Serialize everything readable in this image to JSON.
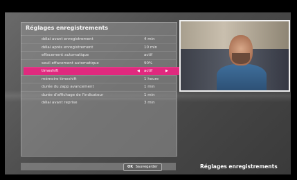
{
  "menu": {
    "title": "Réglages enregistrements",
    "items": [
      {
        "label": "délai avant enregistrement",
        "value": "4 min"
      },
      {
        "label": "délai après enregistrement",
        "value": "10 min"
      },
      {
        "label": "effacement automatique",
        "value": "actif"
      },
      {
        "label": "seuil effacement automatique",
        "value": "90%"
      },
      {
        "label": "timeshift",
        "value": "actif",
        "selected": true
      },
      {
        "label": "mémoire timeshift",
        "value": "1 heure"
      },
      {
        "label": "durée du zapp avancement",
        "value": "1 min"
      },
      {
        "label": "durée d'affichage de l'indicateur",
        "value": "1 min"
      },
      {
        "label": "délai avant reprise",
        "value": "3 min"
      }
    ]
  },
  "footer": {
    "button_key": "OK",
    "button_label": "Sauvegarder"
  },
  "section_label": "Réglages enregistrements",
  "colors": {
    "selection": "#e0297e",
    "panel": "#969696"
  }
}
